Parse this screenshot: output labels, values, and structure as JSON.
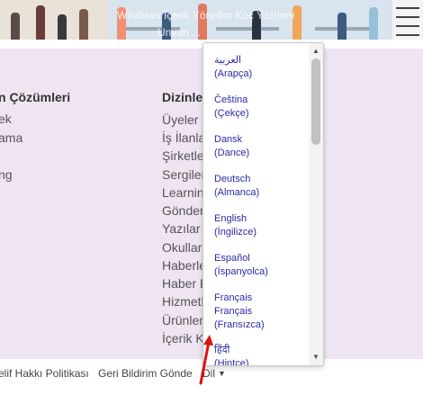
{
  "banner": {
    "overlay_line1": "Windows İçerik Yönetim Koç Yazılımı",
    "overlay_line2": "Unvan  ..."
  },
  "footer": {
    "col1": {
      "title": "n Çözümleri",
      "links": [
        "ek",
        "ama",
        "",
        "ng"
      ]
    },
    "col2": {
      "title": "Dizinler",
      "links": [
        "Üyeler",
        "İş İlanla",
        "Şirketle",
        "Sergiler",
        "Learning",
        "Gönder",
        "Yazılar",
        "Okullar",
        "Haberle",
        "Haber B",
        "Hizmetl",
        "Ürünler",
        "İçerik K"
      ]
    }
  },
  "bottom_bar": {
    "copyright_policy": "elif Hakkı Politikası",
    "feedback": "Geri Bildirim Gönde",
    "language": "Dil"
  },
  "language_menu": {
    "items": [
      {
        "native": "العربية",
        "translated": "(Arapça)"
      },
      {
        "native": "Čeština",
        "translated": "(Çekçe)"
      },
      {
        "native": "Dansk",
        "translated": "(Dance)"
      },
      {
        "native": "Deutsch",
        "translated": "(Almanca)"
      },
      {
        "native": "English",
        "translated": "(İngilizce)"
      },
      {
        "native": "Español",
        "translated": "(İspanyolca)"
      },
      {
        "native": "Français",
        "native2": "Français",
        "translated": "(Fransızca)"
      },
      {
        "native": "हिंदी",
        "translated": "(Hintçe)"
      }
    ],
    "scroll_up_glyph": "▲",
    "scroll_down_glyph": "▼"
  },
  "colors": {
    "footer_bg": "#efe4f2",
    "link_blue": "#2a2aa6",
    "annotation_red": "#e01010"
  }
}
